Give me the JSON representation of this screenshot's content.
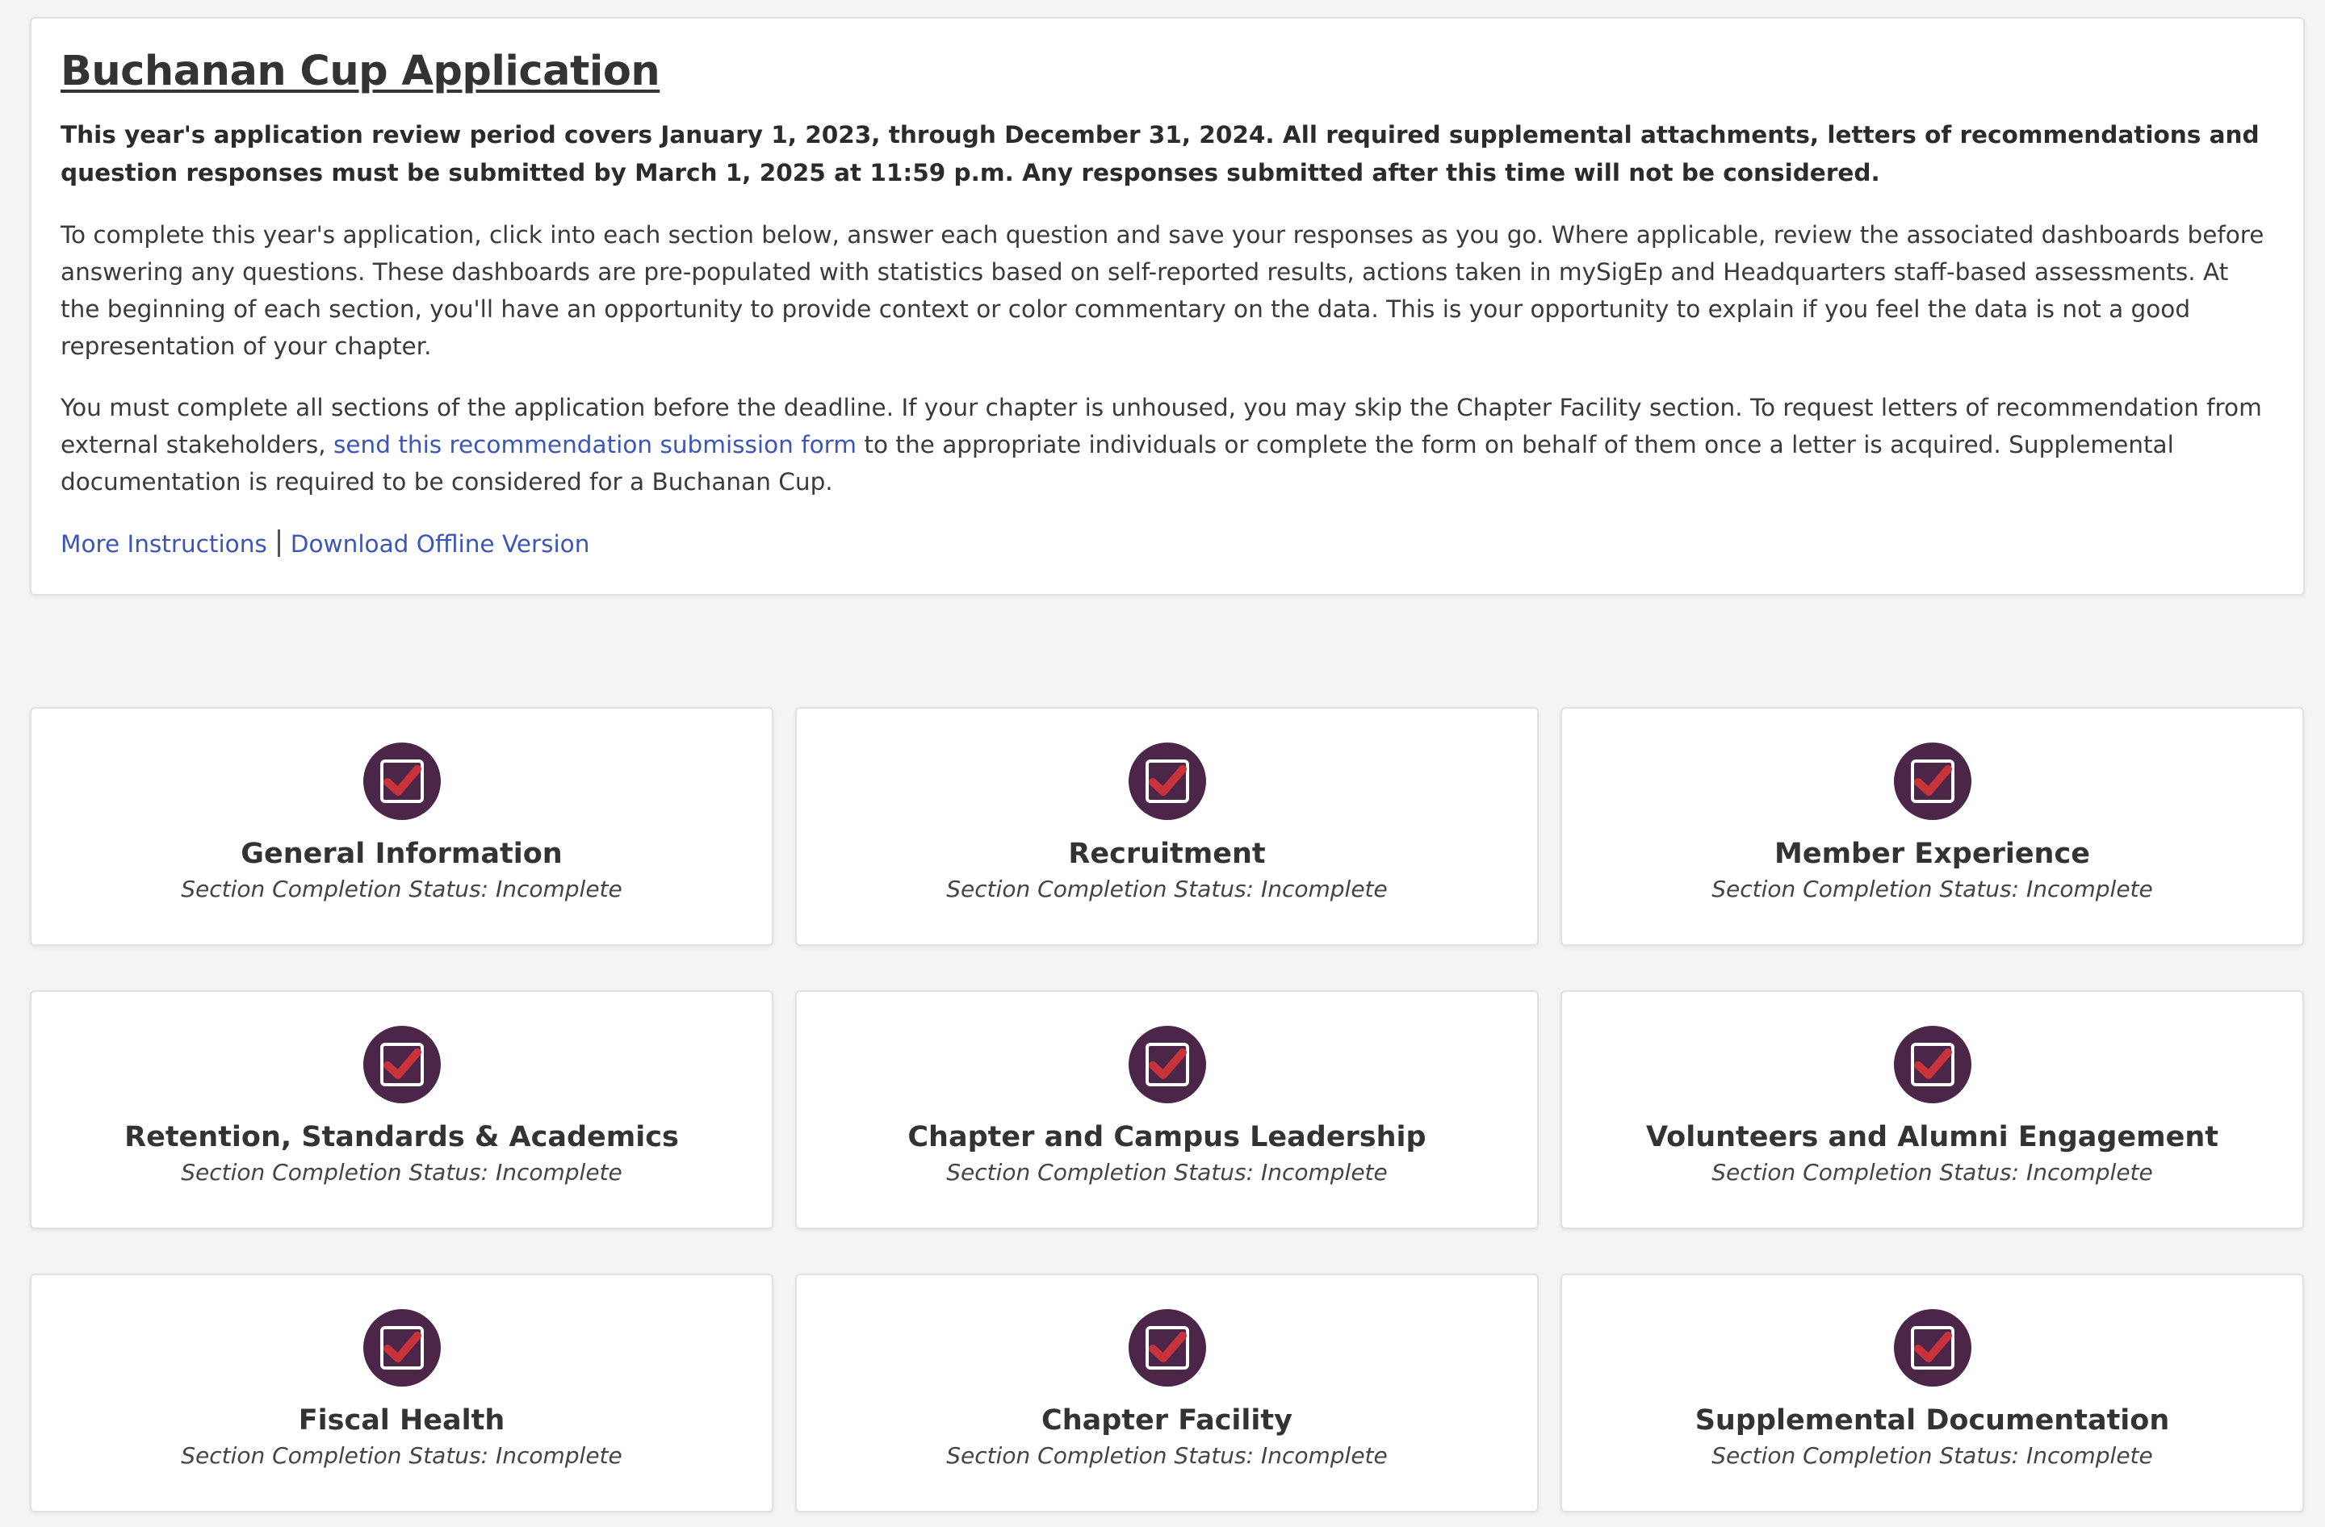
{
  "intro": {
    "title": "Buchanan Cup Application",
    "deadline_notice": "This year's application review period covers January 1, 2023, through December 31, 2024. All required supplemental attachments, letters of recommendations and question responses must be submitted by March 1, 2025 at 11:59 p.m. Any responses submitted after this time will not be considered.",
    "paragraph_1": "To complete this year's application, click into each section below, answer each question and save your responses as you go. Where applicable, review the associated dashboards before answering any questions. These dashboards are pre-populated with statistics based on self-reported results, actions taken in mySigEp and Headquarters staff-based assessments. At the beginning of each section, you'll have an opportunity to provide context or color commentary on the data. This is your opportunity to explain if you feel the data is not a good representation of your chapter.",
    "paragraph_2_before": "You must complete all sections of the application before the deadline. If your chapter is unhoused, you may skip the Chapter Facility section. To request letters of recommendation from external stakeholders, ",
    "paragraph_2_link": "send this recommendation submission form",
    "paragraph_2_after": " to the appropriate individuals or complete the form on behalf of them once a letter is acquired. Supplemental documentation is required to be considered for a Buchanan Cup.",
    "more_instructions_label": "More Instructions",
    "download_offline_label": "Download Offline Version"
  },
  "colors": {
    "icon_circle": "#4b2649",
    "icon_check": "#c8323a",
    "link": "#3b56b8"
  },
  "section_icon_name": "checkbox-checked-icon",
  "sections": [
    {
      "title": "General Information",
      "status": "Section Completion Status: Incomplete"
    },
    {
      "title": "Recruitment",
      "status": "Section Completion Status: Incomplete"
    },
    {
      "title": "Member Experience",
      "status": "Section Completion Status: Incomplete"
    },
    {
      "title": "Retention, Standards & Academics",
      "status": "Section Completion Status: Incomplete"
    },
    {
      "title": "Chapter and Campus Leadership",
      "status": "Section Completion Status: Incomplete"
    },
    {
      "title": "Volunteers and Alumni Engagement",
      "status": "Section Completion Status: Incomplete"
    },
    {
      "title": "Fiscal Health",
      "status": "Section Completion Status: Incomplete"
    },
    {
      "title": "Chapter Facility",
      "status": "Section Completion Status: Incomplete"
    },
    {
      "title": "Supplemental Documentation",
      "status": "Section Completion Status: Incomplete"
    }
  ]
}
